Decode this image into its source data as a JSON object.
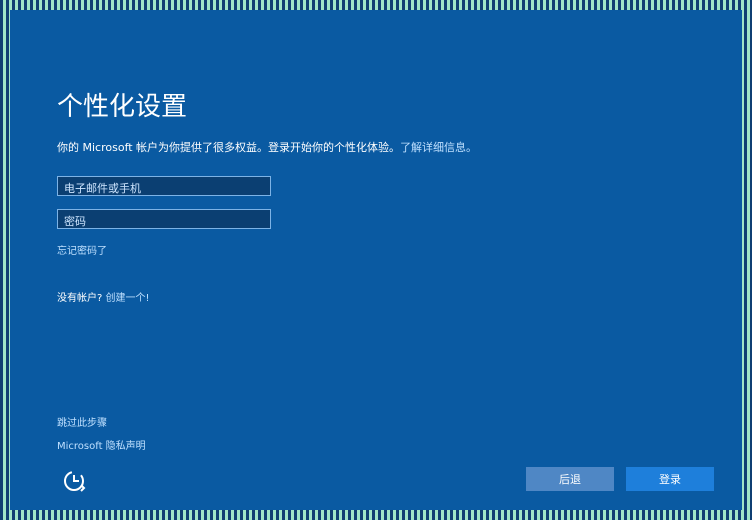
{
  "title": "个性化设置",
  "description": {
    "text": "你的 Microsoft 帐户为你提供了很多权益。登录开始你的个性化体验。",
    "link": "了解详细信息。"
  },
  "inputs": {
    "email_placeholder": "电子邮件或手机",
    "password_placeholder": "密码"
  },
  "links": {
    "forgot_password": "忘记密码了",
    "no_account_text": "没有帐户?",
    "create_one": "创建一个!",
    "skip": "跳过此步骤",
    "privacy": "Microsoft 隐私声明"
  },
  "buttons": {
    "back": "后退",
    "login": "登录"
  },
  "icons": {
    "accessibility": "ease-of-access-icon"
  },
  "colors": {
    "background": "#0a5aa2",
    "button_primary": "#1e7fdb",
    "button_secondary": "#4f87c5",
    "field_bg": "#0b3f72",
    "field_border": "#7db3e6",
    "link": "#bfe0ff"
  }
}
